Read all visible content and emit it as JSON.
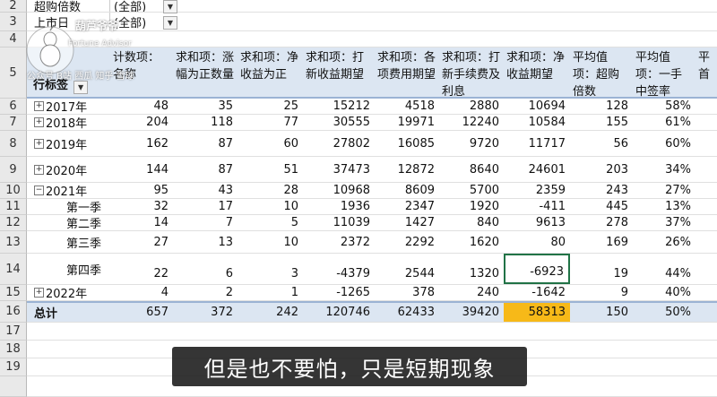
{
  "filters": [
    {
      "row": "2",
      "label": "超购倍数",
      "value": "(全部)"
    },
    {
      "row": "3",
      "label": "上市日",
      "value": "(全部)"
    }
  ],
  "header": {
    "row": "5",
    "row_label": "行标签",
    "columns": [
      "计数项：名称",
      "求和项：涨幅为正数量",
      "求和项：净收益为正",
      "求和项：打新收益期望",
      "求和项：各项费用期望",
      "求和项：打新手续费及利息",
      "求和项：净收益期望",
      "平均值项：超购倍数",
      "平均值项：一手中签率",
      "平首"
    ]
  },
  "rows": [
    {
      "row": "6",
      "label": "2017年",
      "exp": "+",
      "cells": [
        "48",
        "35",
        "25",
        "15212",
        "4518",
        "2880",
        "10694",
        "128",
        "58%"
      ]
    },
    {
      "row": "7",
      "label": "2018年",
      "exp": "+",
      "cells": [
        "204",
        "118",
        "77",
        "30555",
        "19971",
        "12240",
        "10584",
        "155",
        "61%"
      ]
    },
    {
      "row": "8",
      "label": "2019年",
      "exp": "+",
      "cells": [
        "162",
        "87",
        "60",
        "27802",
        "16085",
        "9720",
        "11717",
        "56",
        "60%"
      ]
    },
    {
      "row": "9",
      "label": "2020年",
      "exp": "+",
      "cells": [
        "144",
        "87",
        "51",
        "37473",
        "12872",
        "8640",
        "24601",
        "203",
        "34%"
      ]
    },
    {
      "row": "10",
      "label": "2021年",
      "exp": "-",
      "cells": [
        "95",
        "43",
        "28",
        "10968",
        "8609",
        "5700",
        "2359",
        "243",
        "27%"
      ]
    },
    {
      "row": "11",
      "label": "第一季",
      "exp": "",
      "cells": [
        "32",
        "17",
        "10",
        "1936",
        "2347",
        "1920",
        "-411",
        "445",
        "13%"
      ]
    },
    {
      "row": "12",
      "label": "第二季",
      "exp": "",
      "cells": [
        "14",
        "7",
        "5",
        "11039",
        "1427",
        "840",
        "9613",
        "278",
        "37%"
      ]
    },
    {
      "row": "13",
      "label": "第三季",
      "exp": "",
      "cells": [
        "27",
        "13",
        "10",
        "2372",
        "2292",
        "1620",
        "80",
        "169",
        "26%"
      ]
    },
    {
      "row": "14",
      "label": "第四季",
      "exp": "",
      "cells": [
        "22",
        "6",
        "3",
        "-4379",
        "2544",
        "1320",
        "-6923",
        "19",
        "44%"
      ]
    },
    {
      "row": "15",
      "label": "2022年",
      "exp": "+",
      "cells": [
        "4",
        "2",
        "1",
        "-1265",
        "378",
        "240",
        "-1642",
        "9",
        "40%"
      ]
    },
    {
      "row": "16",
      "label": "总计",
      "exp": "",
      "cells": [
        "657",
        "372",
        "242",
        "120746",
        "62433",
        "39420",
        "58313",
        "150",
        "50%"
      ]
    }
  ],
  "empty_rows": [
    "17",
    "18",
    "19"
  ],
  "watermark": {
    "title": "葫芦爷爷",
    "subtitle": "Fortune Advisor",
    "sources": "公众号 B站 西瓜 知乎 雪球"
  },
  "subtitle": "但是也不要怕，只是短期现象",
  "colors": {
    "highlight": "#f7b918",
    "selected_border": "#217346",
    "row_band": "#dce6f2"
  }
}
